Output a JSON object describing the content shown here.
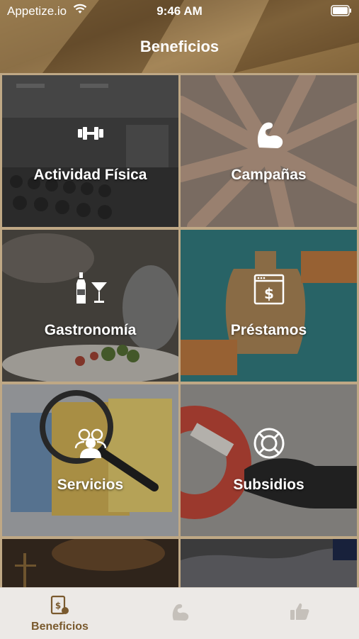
{
  "status_bar": {
    "carrier": "Appetize.io",
    "time": "9:46 AM"
  },
  "header": {
    "title": "Beneficios"
  },
  "tiles": [
    {
      "label": "Actividad Física",
      "icon": "dumbbell-icon"
    },
    {
      "label": "Campañas",
      "icon": "flexed-arm-icon"
    },
    {
      "label": "Gastronomía",
      "icon": "bottle-and-cocktail-icon"
    },
    {
      "label": "Préstamos",
      "icon": "money-browser-icon"
    },
    {
      "label": "Servicios",
      "icon": "people-group-icon"
    },
    {
      "label": "Subsidios",
      "icon": "lifebuoy-icon"
    }
  ],
  "tabbar": {
    "tabs": [
      {
        "label": "Beneficios",
        "icon": "money-tablet-icon",
        "active": true
      },
      {
        "label": "",
        "icon": "flexed-arm-icon",
        "active": false
      },
      {
        "label": "",
        "icon": "thumbs-up-icon",
        "active": false
      }
    ]
  },
  "colors": {
    "accent": "#7a5a2e",
    "header": "#7d6038",
    "inactive_tab": "#c5c0ba"
  }
}
